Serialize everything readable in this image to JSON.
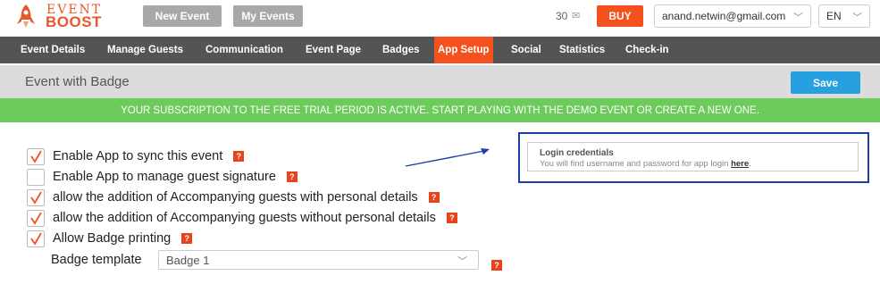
{
  "brand": {
    "line1": "EVENT",
    "line2": "BOOST",
    "color": "#e8572a"
  },
  "header": {
    "new_event": "New Event",
    "my_events": "My Events",
    "credits": "30",
    "credits_icon": "mail-icon",
    "buy": "BUY",
    "account": "anand.netwin@gmail.com",
    "language": "EN"
  },
  "nav": {
    "items": [
      "Event Details",
      "Manage Guests",
      "Communication",
      "Event Page",
      "Badges",
      "App Setup",
      "Social",
      "Statistics",
      "Check-in"
    ],
    "active": "App Setup"
  },
  "page": {
    "title": "Event with Badge",
    "save": "Save"
  },
  "banner": "YOUR SUBSCRIPTION TO THE FREE TRIAL PERIOD IS ACTIVE. START PLAYING WITH THE DEMO EVENT OR CREATE A NEW ONE.",
  "options": [
    {
      "label": "Enable App to sync this event",
      "checked": true
    },
    {
      "label": "Enable App to manage guest signature",
      "checked": false
    },
    {
      "label": "allow the addition of Accompanying guests with personal details",
      "checked": true
    },
    {
      "label": "allow the addition of Accompanying guests without personal details",
      "checked": true
    },
    {
      "label": "Allow Badge printing",
      "checked": true
    }
  ],
  "help_mark": "?",
  "badge": {
    "label": "Badge template",
    "value": "Badge 1"
  },
  "login": {
    "title": "Login credentials",
    "text": "You will find username and password for app login ",
    "link": "here",
    "suffix": "."
  },
  "colors": {
    "accent": "#f4511e",
    "save": "#27a0e0",
    "banner": "#6ccb5a",
    "nav": "#545454",
    "annotation": "#1f3fa8"
  }
}
